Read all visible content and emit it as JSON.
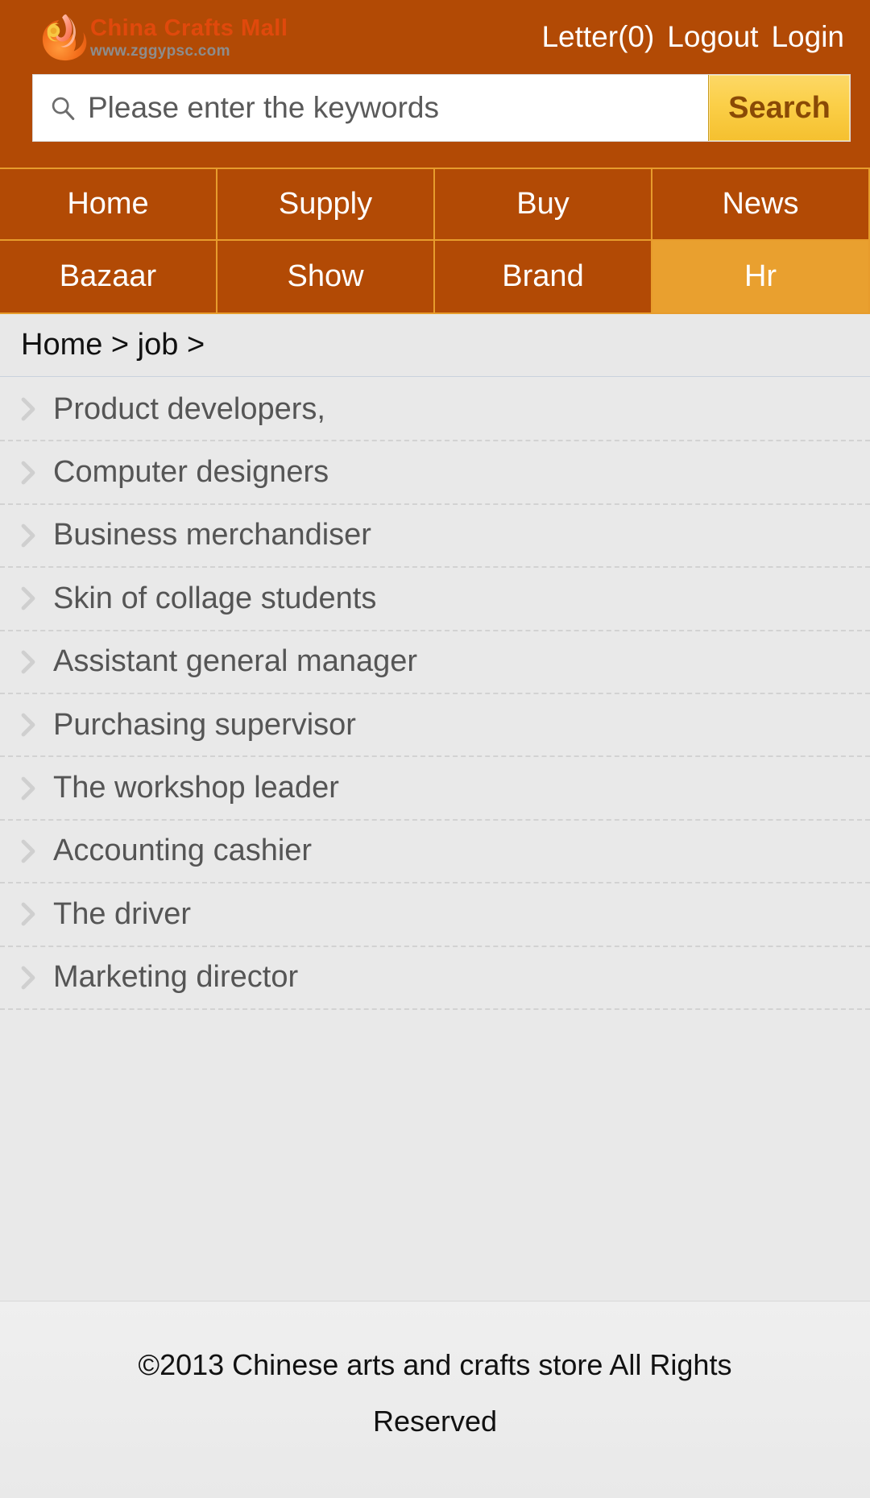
{
  "brand": {
    "logo_icon": "phoenix-flame-logo-icon",
    "title": "China Crafts Mall",
    "url": "www.zggypsc.com",
    "accent_dark": "#b24a05",
    "accent_light": "#e79c2c",
    "logo_title_color": "#e4490d",
    "logo_url_color": "#8d8d8d"
  },
  "header": {
    "links": [
      {
        "label": "Letter(0)",
        "name": "letter-link"
      },
      {
        "label": "Logout",
        "name": "logout-link"
      },
      {
        "label": "Login",
        "name": "login-link"
      }
    ]
  },
  "search": {
    "icon": "search-icon",
    "placeholder": "Please enter the keywords",
    "value": "",
    "button_label": "Search",
    "button_color": "#fbcf48",
    "button_text_color": "#8a4a06"
  },
  "nav": {
    "items": [
      {
        "label": "Home",
        "active": false
      },
      {
        "label": "Supply",
        "active": false
      },
      {
        "label": "Buy",
        "active": false
      },
      {
        "label": "News",
        "active": false
      },
      {
        "label": "Bazaar",
        "active": false
      },
      {
        "label": "Show",
        "active": false
      },
      {
        "label": "Brand",
        "active": false
      },
      {
        "label": "Hr",
        "active": true
      }
    ],
    "active_color": "#e9a02f"
  },
  "breadcrumb": {
    "text": "Home > job >"
  },
  "job_list": {
    "item_icon": "chevron-right-icon",
    "items": [
      {
        "label": "Product developers,"
      },
      {
        "label": "Computer designers"
      },
      {
        "label": "Business merchandiser"
      },
      {
        "label": "Skin of collage students"
      },
      {
        "label": "Assistant general manager"
      },
      {
        "label": "Purchasing supervisor"
      },
      {
        "label": "The workshop leader"
      },
      {
        "label": "Accounting cashier"
      },
      {
        "label": "The driver"
      },
      {
        "label": "Marketing director"
      }
    ]
  },
  "footer": {
    "copyright": "©2013 Chinese arts and crafts store All Rights Reserved"
  }
}
